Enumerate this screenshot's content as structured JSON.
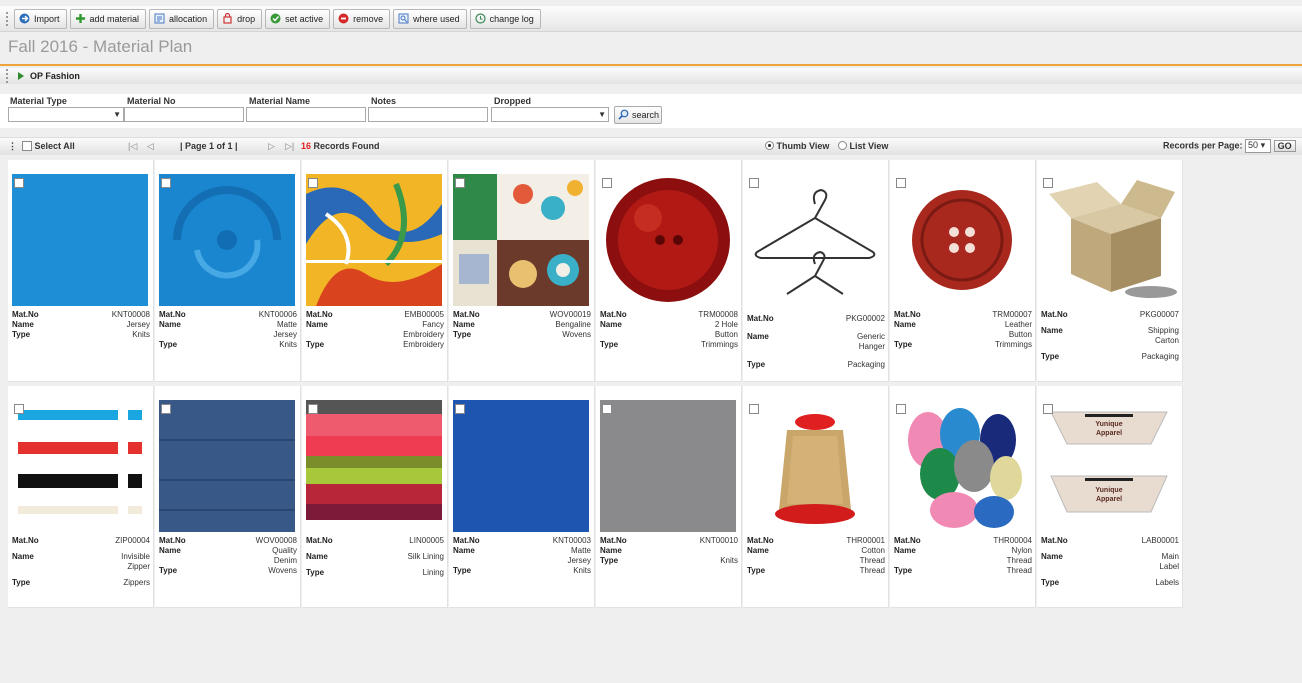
{
  "toolbar": {
    "buttons": [
      {
        "label": "Import",
        "icon": "import-icon"
      },
      {
        "label": "add material",
        "icon": "plus-icon"
      },
      {
        "label": "allocation",
        "icon": "allocation-icon"
      },
      {
        "label": "drop",
        "icon": "drop-icon"
      },
      {
        "label": "set active",
        "icon": "check-icon"
      },
      {
        "label": "remove",
        "icon": "remove-icon"
      },
      {
        "label": "where used",
        "icon": "where-used-icon"
      },
      {
        "label": "change log",
        "icon": "change-log-icon"
      }
    ]
  },
  "page": {
    "title": "Fall 2016 - Material Plan",
    "section": "OP Fashion"
  },
  "filters": {
    "material_type": "Material Type",
    "material_no": "Material No",
    "material_name": "Material Name",
    "notes": "Notes",
    "dropped": "Dropped",
    "search": "search"
  },
  "pager": {
    "select_all": "Select All",
    "page_info": "| Page 1 of 1 |",
    "records_count": "16",
    "records_label": "Records Found",
    "thumb_view": "Thumb View",
    "list_view": "List View",
    "records_per_page": "Records per Page:",
    "per_page_value": "50",
    "go": "GO"
  },
  "labels": {
    "mat_no": "Mat.No",
    "name": "Name",
    "type": "Type"
  },
  "colors": {
    "accent": "#f0a23a",
    "records": "#d22222"
  },
  "materials": [
    {
      "no": "KNT00008",
      "name": "Jersey",
      "type": "Knits",
      "thumb": "blue-fabric"
    },
    {
      "no": "KNT00006",
      "name": "Matte Jersey",
      "type": "Knits",
      "thumb": "blue-swirl-fabric"
    },
    {
      "no": "EMB00005",
      "name": "Fancy Embroidery",
      "type": "Embroidery",
      "thumb": "feather-print"
    },
    {
      "no": "WOV00019",
      "name": "Bengaline",
      "type": "Wovens",
      "thumb": "circle-prints"
    },
    {
      "no": "TRM00008",
      "name": "2 Hole Button",
      "type": "Trimmings",
      "thumb": "red-button"
    },
    {
      "no": "PKG00002",
      "name": "Generic Hanger",
      "type": "Packaging",
      "thumb": "hanger"
    },
    {
      "no": "TRM00007",
      "name": "Leather Button",
      "type": "Trimmings",
      "thumb": "leather-button"
    },
    {
      "no": "PKG00007",
      "name": "Shipping Carton",
      "type": "Packaging",
      "thumb": "carton-box"
    },
    {
      "no": "ZIP00004",
      "name": "Invisible Zipper",
      "type": "Zippers",
      "thumb": "zippers"
    },
    {
      "no": "WOV00008",
      "name": "Quality Denim",
      "type": "Wovens",
      "thumb": "denim"
    },
    {
      "no": "LIN00005",
      "name": "Silk Lining",
      "type": "Lining",
      "thumb": "silk-stack"
    },
    {
      "no": "KNT00003",
      "name": "Matte Jersey",
      "type": "Knits",
      "thumb": "royal-blue-fabric"
    },
    {
      "no": "KNT00010",
      "name": "",
      "type": "Knits",
      "thumb": "grey-fabric"
    },
    {
      "no": "THR00001",
      "name": "Cotton Thread",
      "type": "Thread",
      "thumb": "thread-cone"
    },
    {
      "no": "THR00004",
      "name": "Nylon Thread",
      "type": "Thread",
      "thumb": "thread-spools"
    },
    {
      "no": "LAB00001",
      "name": "Main Label",
      "type": "Labels",
      "thumb": "label-tags",
      "label_text": "Yunique Apparel"
    }
  ]
}
